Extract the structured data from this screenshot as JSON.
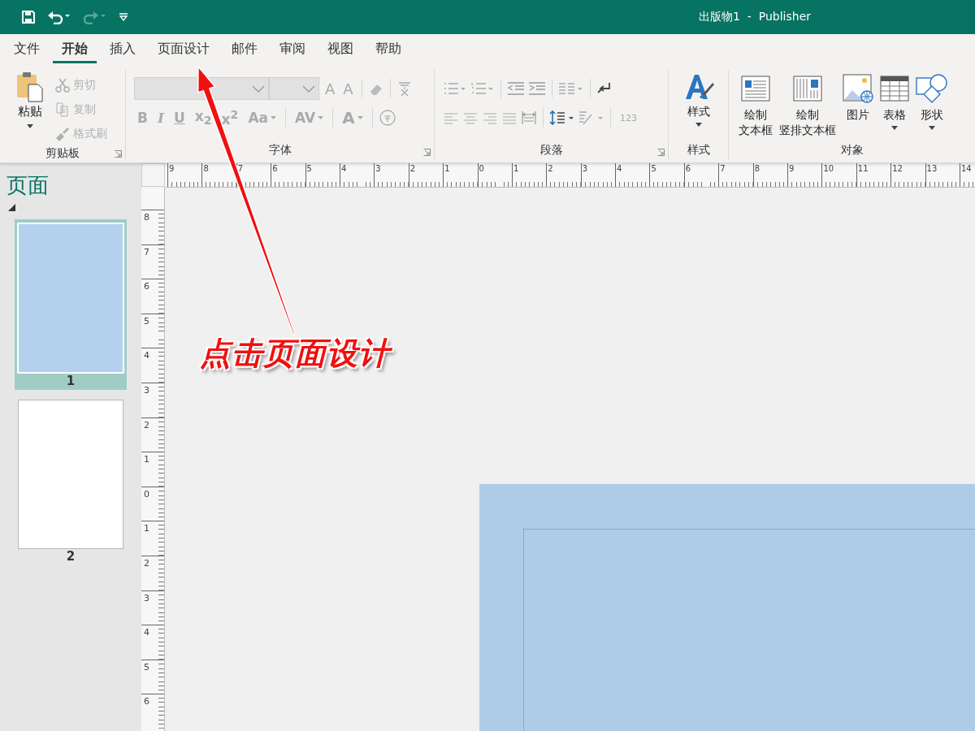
{
  "title_bar": {
    "title": "出版物1  -  Publisher"
  },
  "quick_access": [
    {
      "kind": "save",
      "disabled": false
    },
    {
      "kind": "undo",
      "disabled": false
    },
    {
      "kind": "redo",
      "disabled": true
    },
    {
      "kind": "customize",
      "disabled": false
    }
  ],
  "tabs": [
    {
      "label": "文件",
      "selected": false
    },
    {
      "label": "开始",
      "selected": true
    },
    {
      "label": "插入",
      "selected": false
    },
    {
      "label": "页面设计",
      "selected": false
    },
    {
      "label": "邮件",
      "selected": false
    },
    {
      "label": "审阅",
      "selected": false
    },
    {
      "label": "视图",
      "selected": false
    },
    {
      "label": "帮助",
      "selected": false
    }
  ],
  "ribbon": {
    "clipboard": {
      "label": "剪贴板",
      "paste": "粘贴",
      "commands": [
        {
          "kind": "cut",
          "label": "剪切",
          "disabled": true
        },
        {
          "kind": "copy",
          "label": "复制",
          "disabled": true
        },
        {
          "kind": "format_painter",
          "label": "格式刷",
          "disabled": true
        }
      ]
    },
    "font": {
      "label": "字体",
      "size_buttons": [
        "A",
        "A"
      ],
      "format_buttons": [
        {
          "text": "B",
          "dropdown": false
        },
        {
          "text": "I",
          "dropdown": false
        },
        {
          "text": "U",
          "dropdown": false
        },
        {
          "text": "x$_{2}$",
          "dropdown": false
        },
        {
          "text": "x$^{2}$",
          "dropdown": false
        },
        {
          "text": "Aa",
          "dropdown": true
        },
        {
          "text": "AV",
          "dropdown": true
        },
        {
          "text": "A",
          "dropdown": true
        }
      ]
    },
    "paragraph": {
      "label": "段落",
      "numbering_text": "123"
    },
    "styles": {
      "label": "样式",
      "button": "样式"
    },
    "objects": {
      "label": "对象",
      "buttons": [
        {
          "kind": "text_box",
          "lines": [
            "绘制",
            "文本框"
          ],
          "dropdown": false
        },
        {
          "kind": "vertical_text_box",
          "lines": [
            "绘制",
            "竖排文本框"
          ],
          "dropdown": false
        },
        {
          "kind": "picture",
          "lines": [
            "图片"
          ],
          "dropdown": false
        },
        {
          "kind": "table",
          "lines": [
            "表格"
          ],
          "dropdown": true
        },
        {
          "kind": "shapes",
          "lines": [
            "形状"
          ],
          "dropdown": true
        }
      ]
    }
  },
  "pages_panel": {
    "title": "页面",
    "pages": [
      {
        "number": "1",
        "selected": true,
        "color": "#b4d0ef"
      },
      {
        "number": "2",
        "selected": false,
        "color": "#ffffff"
      }
    ]
  },
  "rulers": {
    "horizontal": [
      "9",
      "8",
      "7",
      "6",
      "5",
      "4",
      "3",
      "2",
      "1",
      "0",
      "1",
      "2",
      "3",
      "4",
      "5",
      "6",
      "7",
      "8",
      "9",
      "10",
      "11",
      "12",
      "13",
      "14"
    ],
    "vertical": [
      "8",
      "7",
      "6",
      "5",
      "4",
      "3",
      "2",
      "1",
      "0",
      "1",
      "2",
      "3",
      "4",
      "5",
      "6"
    ]
  },
  "annotation": {
    "text": "点击页面设计"
  }
}
